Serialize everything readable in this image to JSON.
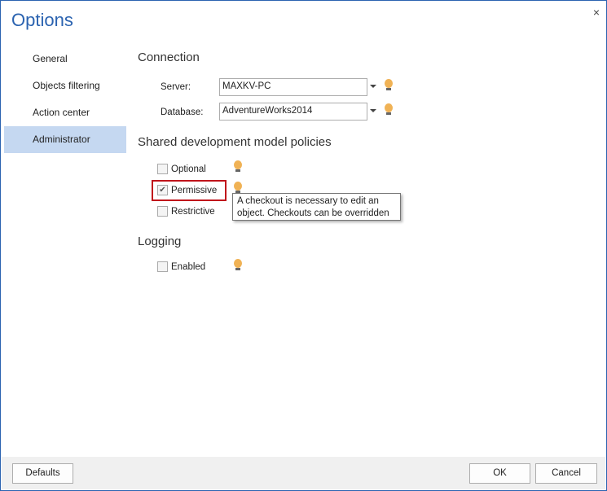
{
  "window": {
    "title": "Options",
    "close_icon": "×"
  },
  "nav": {
    "items": [
      "General",
      "Objects filtering",
      "Action center",
      "Administrator"
    ],
    "selected": "Administrator"
  },
  "connection": {
    "heading": "Connection",
    "server_label": "Server:",
    "server_value": "MAXKV-PC",
    "database_label": "Database:",
    "database_value": "AdventureWorks2014"
  },
  "policies": {
    "heading": "Shared development model policies",
    "options": [
      {
        "label": "Optional",
        "checked": false
      },
      {
        "label": "Permissive",
        "checked": true
      },
      {
        "label": "Restrictive",
        "checked": false
      }
    ],
    "tooltip": "A checkout is necessary to edit an object. Checkouts can be overridden"
  },
  "logging": {
    "heading": "Logging",
    "enabled_label": "Enabled",
    "enabled": false
  },
  "footer": {
    "defaults": "Defaults",
    "ok": "OK",
    "cancel": "Cancel"
  }
}
